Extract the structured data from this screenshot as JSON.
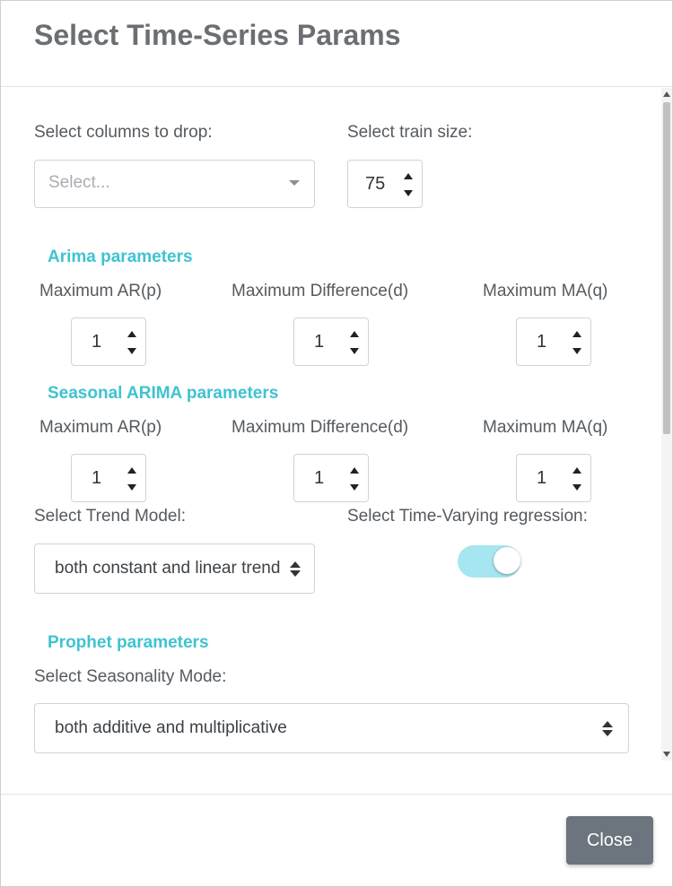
{
  "modal": {
    "title": "Select Time-Series Params",
    "close_label": "Close"
  },
  "columns_drop": {
    "label": "Select columns to drop:",
    "placeholder": "Select..."
  },
  "train_size": {
    "label": "Select train size:",
    "value": "75"
  },
  "arima": {
    "title": "Arima parameters",
    "ar_label": "Maximum AR(p)",
    "diff_label": "Maximum Difference(d)",
    "ma_label": "Maximum MA(q)",
    "ar_value": "1",
    "diff_value": "1",
    "ma_value": "1"
  },
  "seasonal_arima": {
    "title": "Seasonal ARIMA parameters",
    "ar_label": "Maximum AR(p)",
    "diff_label": "Maximum Difference(d)",
    "ma_label": "Maximum MA(q)",
    "ar_value": "1",
    "diff_value": "1",
    "ma_value": "1"
  },
  "trend_model": {
    "label": "Select Trend Model:",
    "value": "both constant and linear trend"
  },
  "time_varying": {
    "label": "Select Time-Varying regression:",
    "enabled": true
  },
  "prophet": {
    "title": "Prophet parameters",
    "seasonality_label": "Select Seasonality Mode:",
    "seasonality_value": "both additive and multiplicative"
  },
  "colors": {
    "accent": "#3fc3d1",
    "toggle_on": "#a6e6f0",
    "button": "#6c757d"
  }
}
